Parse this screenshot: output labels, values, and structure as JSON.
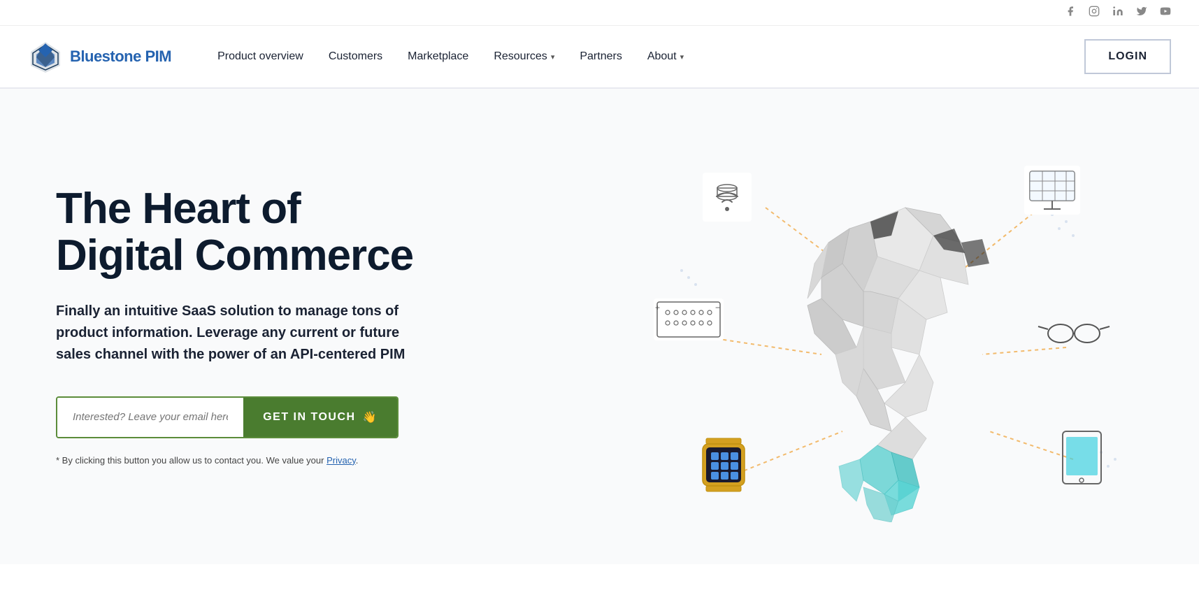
{
  "social": {
    "links": [
      "facebook",
      "instagram",
      "linkedin",
      "twitter",
      "youtube"
    ]
  },
  "nav": {
    "logo_text_1": "Bluestone",
    "logo_text_2": " PIM",
    "links": [
      {
        "label": "Product overview",
        "has_dropdown": false
      },
      {
        "label": "Customers",
        "has_dropdown": false
      },
      {
        "label": "Marketplace",
        "has_dropdown": false
      },
      {
        "label": "Resources",
        "has_dropdown": true
      },
      {
        "label": "Partners",
        "has_dropdown": false
      },
      {
        "label": "About",
        "has_dropdown": true
      }
    ],
    "login_label": "LOGIN"
  },
  "hero": {
    "title_line1": "The Heart of",
    "title_line2": "Digital Commerce",
    "subtitle": "Finally an intuitive SaaS solution to manage tons of product information. Leverage any current or future sales channel with the power of an API-centered PIM",
    "cta_input_placeholder": "Interested? Leave your email here!",
    "cta_button_label": "GET IN TOUCH",
    "cta_button_emoji": "👋",
    "disclaimer_text": "* By clicking this button you allow us to contact you. We value your",
    "privacy_label": "Privacy"
  }
}
